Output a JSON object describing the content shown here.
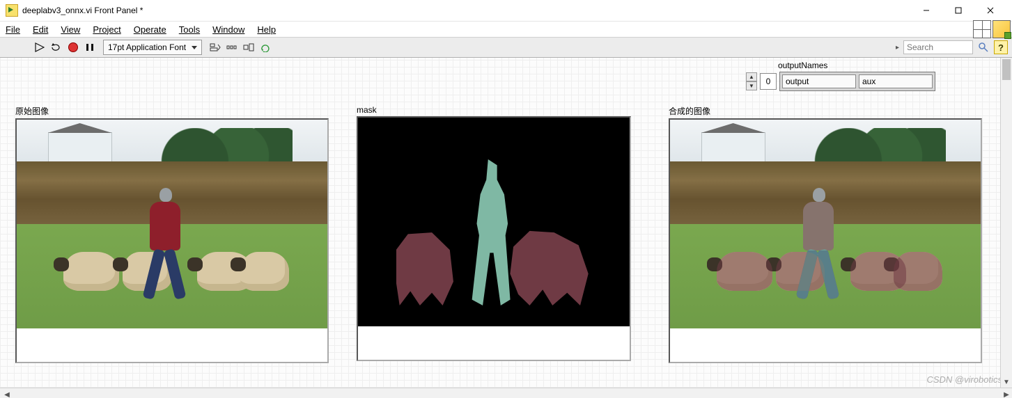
{
  "window": {
    "title": "deeplabv3_onnx.vi Front Panel *",
    "win_min": "Minimize",
    "win_max": "Maximize",
    "win_close": "Close"
  },
  "menu": {
    "file": "File",
    "edit": "Edit",
    "view": "View",
    "project": "Project",
    "operate": "Operate",
    "tools": "Tools",
    "window": "Window",
    "help": "Help"
  },
  "toolbar": {
    "run_tip": "Run",
    "run_cont_tip": "Run Continuously",
    "abort_tip": "Abort Execution",
    "pause_tip": "Pause",
    "font_label": "17pt Application Font",
    "align_tip": "Align Objects",
    "distribute_tip": "Distribute Objects",
    "resize_tip": "Resize Objects",
    "reorder_tip": "Reorder",
    "search_placeholder": "Search",
    "search_tip": "Search",
    "help_tip": "Context Help"
  },
  "outputNames": {
    "caption": "outputNames",
    "index": "0",
    "cells": [
      "output",
      "aux"
    ]
  },
  "panels": {
    "img1_caption": "原始图像",
    "img2_caption": "mask",
    "img3_caption": "合成的图像"
  },
  "watermark": "CSDN @virobotics"
}
